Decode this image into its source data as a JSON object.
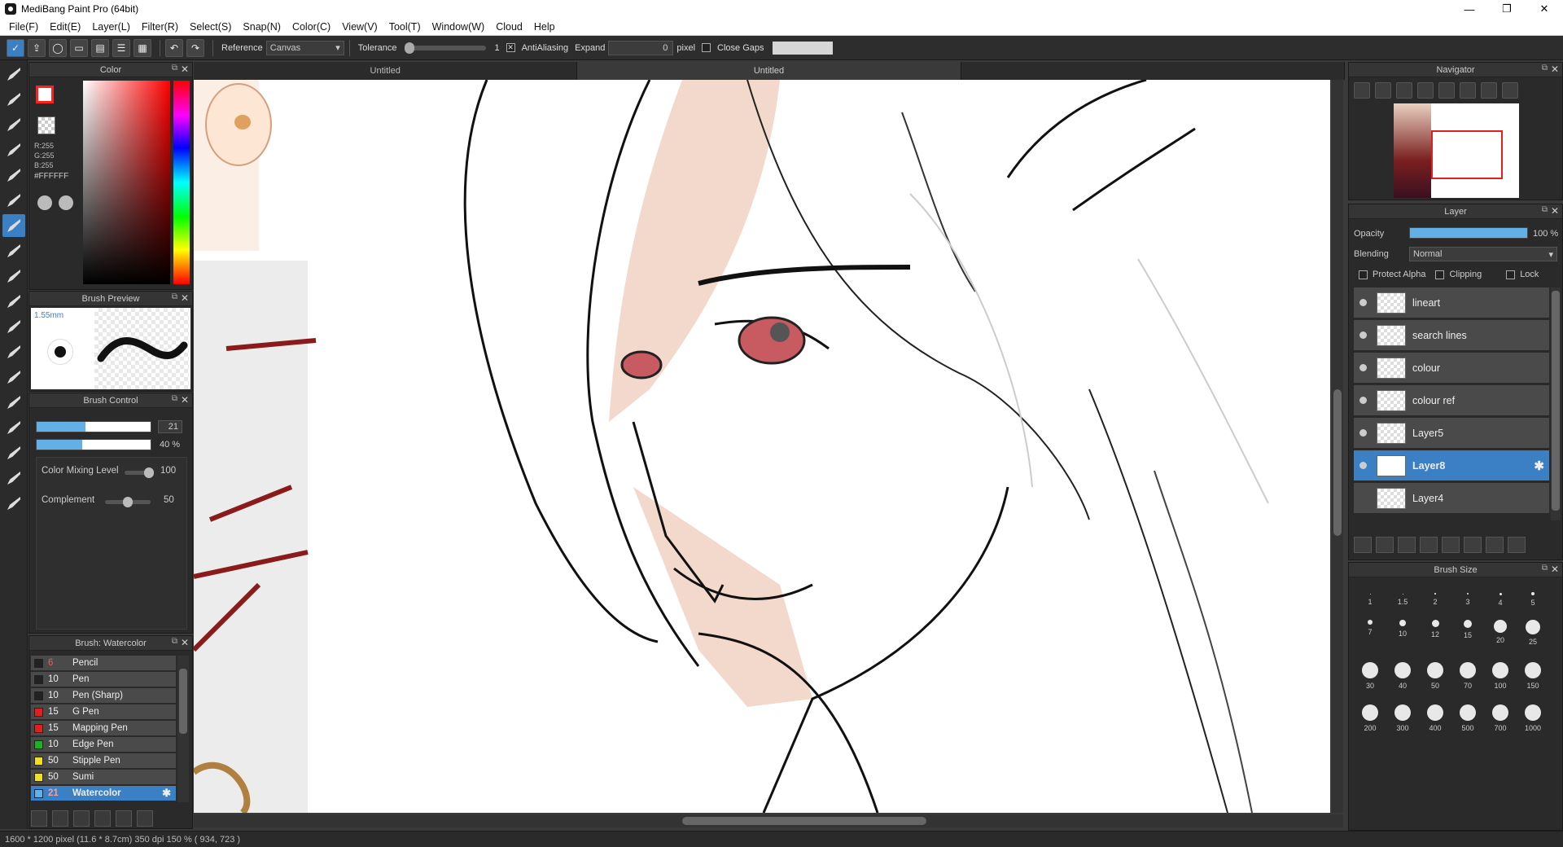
{
  "window": {
    "title": "MediBang Paint Pro (64bit)",
    "minimize": "—",
    "restore": "❐",
    "close": "✕"
  },
  "menu": [
    "File(F)",
    "Edit(E)",
    "Layer(L)",
    "Filter(R)",
    "Select(S)",
    "Snap(N)",
    "Color(C)",
    "View(V)",
    "Tool(T)",
    "Window(W)",
    "Cloud",
    "Help"
  ],
  "toolbar": {
    "reference_label": "Reference",
    "reference_value": "Canvas",
    "tolerance_label": "Tolerance",
    "tolerance_value": "1",
    "antialiasing_label": "AntiAliasing",
    "expand_label": "Expand",
    "expand_value": "0",
    "expand_unit": "pixel",
    "close_gaps_label": "Close Gaps"
  },
  "tabs": [
    {
      "label": "Untitled"
    },
    {
      "label": "Untitled"
    },
    {
      "label": ""
    }
  ],
  "color_panel": {
    "title": "Color",
    "r": "R:255",
    "g": "G:255",
    "b": "B:255",
    "hex": "#FFFFFF",
    "fg": "#ff2020"
  },
  "brush_preview": {
    "title": "Brush Preview",
    "size": "1.55mm"
  },
  "brush_control": {
    "title": "Brush Control",
    "size_value": "21",
    "size_fill": 0.43,
    "opacity_value": "40 %",
    "opacity_fill": 0.4,
    "mixing_label": "Color Mixing Level",
    "mixing_value": "100",
    "mixing_level": 1.0,
    "complement_label": "Complement",
    "complement_value": "50",
    "complement_level": 0.5
  },
  "brush_list": {
    "title": "Brush: Watercolor",
    "items": [
      {
        "size": "6",
        "name": "Pencil",
        "color": "#222222"
      },
      {
        "size": "10",
        "name": "Pen",
        "color": "#222222"
      },
      {
        "size": "10",
        "name": "Pen (Sharp)",
        "color": "#222222"
      },
      {
        "size": "15",
        "name": "G Pen",
        "color": "#e02020"
      },
      {
        "size": "15",
        "name": "Mapping Pen",
        "color": "#e02020"
      },
      {
        "size": "10",
        "name": "Edge Pen",
        "color": "#20b020"
      },
      {
        "size": "50",
        "name": "Stipple Pen",
        "color": "#f0e020"
      },
      {
        "size": "50",
        "name": "Sumi",
        "color": "#f0e020"
      },
      {
        "size": "21",
        "name": "Watercolor",
        "color": "#62b0e6"
      }
    ]
  },
  "navigator": {
    "title": "Navigator"
  },
  "layer_panel": {
    "title": "Layer",
    "opacity_label": "Opacity",
    "opacity_value": "100 %",
    "opacity_fill": 1.0,
    "blending_label": "Blending",
    "blending_value": "Normal",
    "protect_alpha": "Protect Alpha",
    "clipping": "Clipping",
    "lock": "Lock",
    "layers": [
      "lineart",
      "search lines",
      "colour",
      "colour ref",
      "Layer5",
      "Layer8",
      "Layer4"
    ],
    "selected": "Layer8"
  },
  "brush_size": {
    "title": "Brush Size",
    "sizes": [
      "1",
      "1.5",
      "2",
      "3",
      "4",
      "5",
      "7",
      "10",
      "12",
      "15",
      "20",
      "25",
      "30",
      "40",
      "50",
      "70",
      "100",
      "150",
      "200",
      "300",
      "400",
      "500",
      "700",
      "1000"
    ]
  },
  "status": {
    "text": "1600 * 1200 pixel  (11.6 * 8.7cm)  350 dpi  150 %  ( 934, 723 )"
  }
}
